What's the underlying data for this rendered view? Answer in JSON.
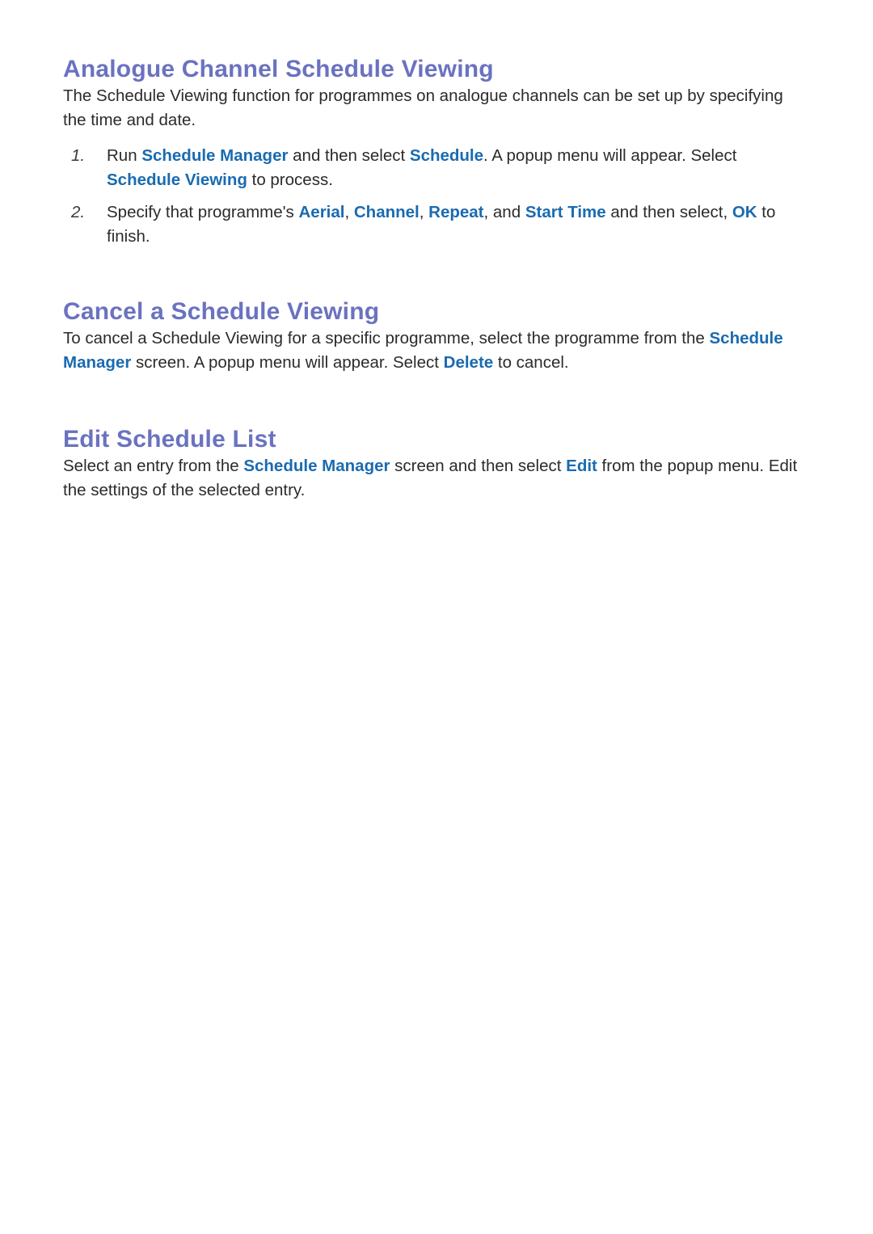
{
  "document": {
    "colors": {
      "heading": "#6a72c0",
      "highlight": "#1a6bb0",
      "body_text": "#2b2b2b",
      "background": "#ffffff"
    },
    "sections": [
      {
        "heading": "Analogue Channel Schedule Viewing",
        "intro": {
          "t1": "The Schedule Viewing function for programmes on analogue channels can be set up by specifying the time and date."
        },
        "steps": [
          {
            "number": "1.",
            "t1": "Run ",
            "h1": "Schedule Manager",
            "t2": " and then select ",
            "h2": "Schedule",
            "t3": ". A popup menu will appear. Select ",
            "h3": "Schedule Viewing",
            "t4": " to process."
          },
          {
            "number": "2.",
            "t1": "Specify that programme's ",
            "h1": "Aerial",
            "t2": ", ",
            "h2": "Channel",
            "t3": ", ",
            "h3": "Repeat",
            "t4": ", and ",
            "h4": "Start Time",
            "t5": " and then select, ",
            "h5": "OK",
            "t6": " to finish."
          }
        ]
      },
      {
        "heading": "Cancel a Schedule Viewing",
        "paragraph": {
          "t1": "To cancel a Schedule Viewing for a specific programme, select the programme from the ",
          "h1": "Schedule Manager",
          "t2": " screen. A popup menu will appear. Select ",
          "h2": "Delete",
          "t3": " to cancel."
        }
      },
      {
        "heading": "Edit Schedule List",
        "paragraph": {
          "t1": "Select an entry from the ",
          "h1": "Schedule Manager",
          "t2": " screen and then select ",
          "h2": "Edit",
          "t3": " from the popup menu. Edit the settings of the selected entry."
        }
      }
    ]
  }
}
